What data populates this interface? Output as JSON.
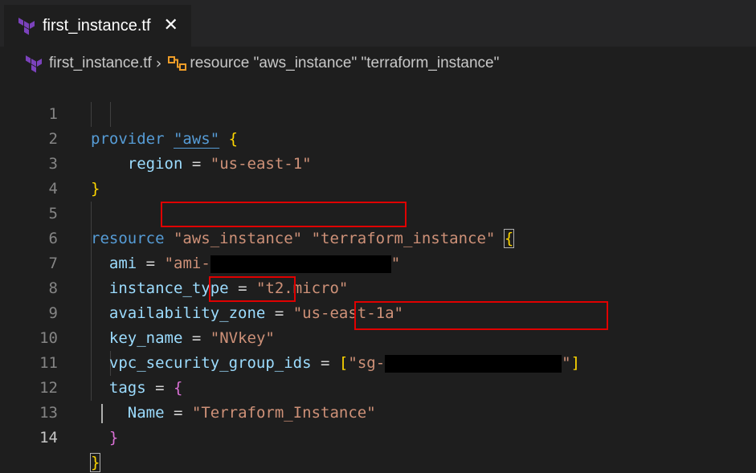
{
  "tab": {
    "filename": "first_instance.tf",
    "close_glyph": "✕",
    "icon": "terraform-icon"
  },
  "breadcrumb": {
    "file": "first_instance.tf",
    "separator": "›",
    "symbol_icon": "symbol-class-icon",
    "symbol": "resource \"aws_instance\" \"terraform_instance\""
  },
  "editor": {
    "active_line": 14,
    "lines": [
      {
        "n": "1"
      },
      {
        "n": "2"
      },
      {
        "n": "3"
      },
      {
        "n": "4"
      },
      {
        "n": "5"
      },
      {
        "n": "6"
      },
      {
        "n": "7"
      },
      {
        "n": "8"
      },
      {
        "n": "9"
      },
      {
        "n": "10"
      },
      {
        "n": "11"
      },
      {
        "n": "12"
      },
      {
        "n": "13"
      },
      {
        "n": "14"
      }
    ],
    "tokens": {
      "l1_kw": "provider",
      "l1_str": "\"aws\"",
      "l2_attr": "region",
      "l2_str": "\"us-east-1\"",
      "l5_kw": "resource",
      "l5_str1": "\"aws_instance\"",
      "l5_str2": "\"terraform_instance\"",
      "l6_attr": "ami",
      "l6_str_open": "\"ami-",
      "l6_str_close": "\"",
      "l7_attr": "instance_type",
      "l7_str": "\"t2.micro\"",
      "l8_attr": "availability_zone",
      "l8_str": "\"us-east-1a\"",
      "l9_attr": "key_name",
      "l9_str": "\"NVkey\"",
      "l10_attr": "vpc_security_group_ids",
      "l10_str_open": "\"sg-",
      "l10_str_close": "\"",
      "l11_attr": "tags",
      "l12_attr": "Name",
      "l12_str": "\"Terraform_Instance\"",
      "eq": "=",
      "open_brace": "{",
      "close_brace": "}",
      "open_bracket": "[",
      "close_bracket": "]"
    }
  },
  "colors": {
    "background": "#1e1e1e",
    "keyword": "#569cd6",
    "string": "#ce9178",
    "attribute": "#9cdcfe",
    "highlight_box": "#e00000",
    "terraform_purple": "#7b42bc",
    "symbol_orange": "#ee9d28"
  }
}
